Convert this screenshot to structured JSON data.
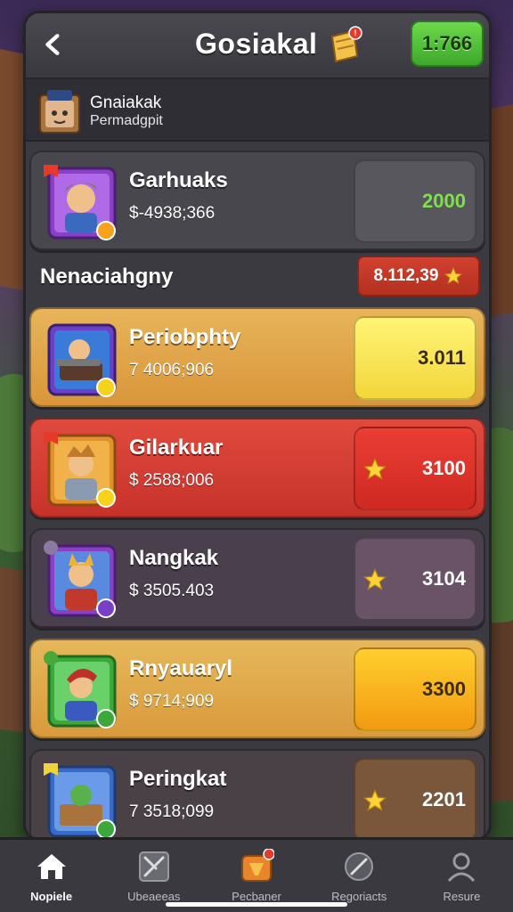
{
  "header": {
    "title": "Gosiakal",
    "coins": "1:766"
  },
  "profile": {
    "name": "Gnaiakak",
    "subtitle": "Permadgpit"
  },
  "featured": {
    "name": "Garhuaks",
    "price": "$-4938;366",
    "value": "2000"
  },
  "section": {
    "title": "Nenaciahgny",
    "badge": "8.112,39"
  },
  "rows": [
    {
      "name": "Periobphty",
      "price": "7 4006;906",
      "value": "3.011"
    },
    {
      "name": "Gilarkuar",
      "price": "$ 2588;006",
      "value": "3100"
    },
    {
      "name": "Nangkak",
      "price": "$ 3505.403",
      "value": "3104"
    },
    {
      "name": "Rnyauaryl",
      "price": "$ 9714;909",
      "value": "3300"
    },
    {
      "name": "Peringkat",
      "price": "7 3518;099",
      "value": "2201"
    }
  ],
  "nav": [
    {
      "label": "Nopiele",
      "icon": "home-icon"
    },
    {
      "label": "Ubeaeeas",
      "icon": "swords-icon"
    },
    {
      "label": "Pecbaner",
      "icon": "shop-icon"
    },
    {
      "label": "Regoriacts",
      "icon": "compass-icon"
    },
    {
      "label": "Resure",
      "icon": "profile-icon"
    }
  ],
  "colors": {
    "accent_green": "#4fbf33",
    "accent_red": "#d2402f",
    "accent_gold": "#f3d63a",
    "panel": "#3b3a40"
  }
}
